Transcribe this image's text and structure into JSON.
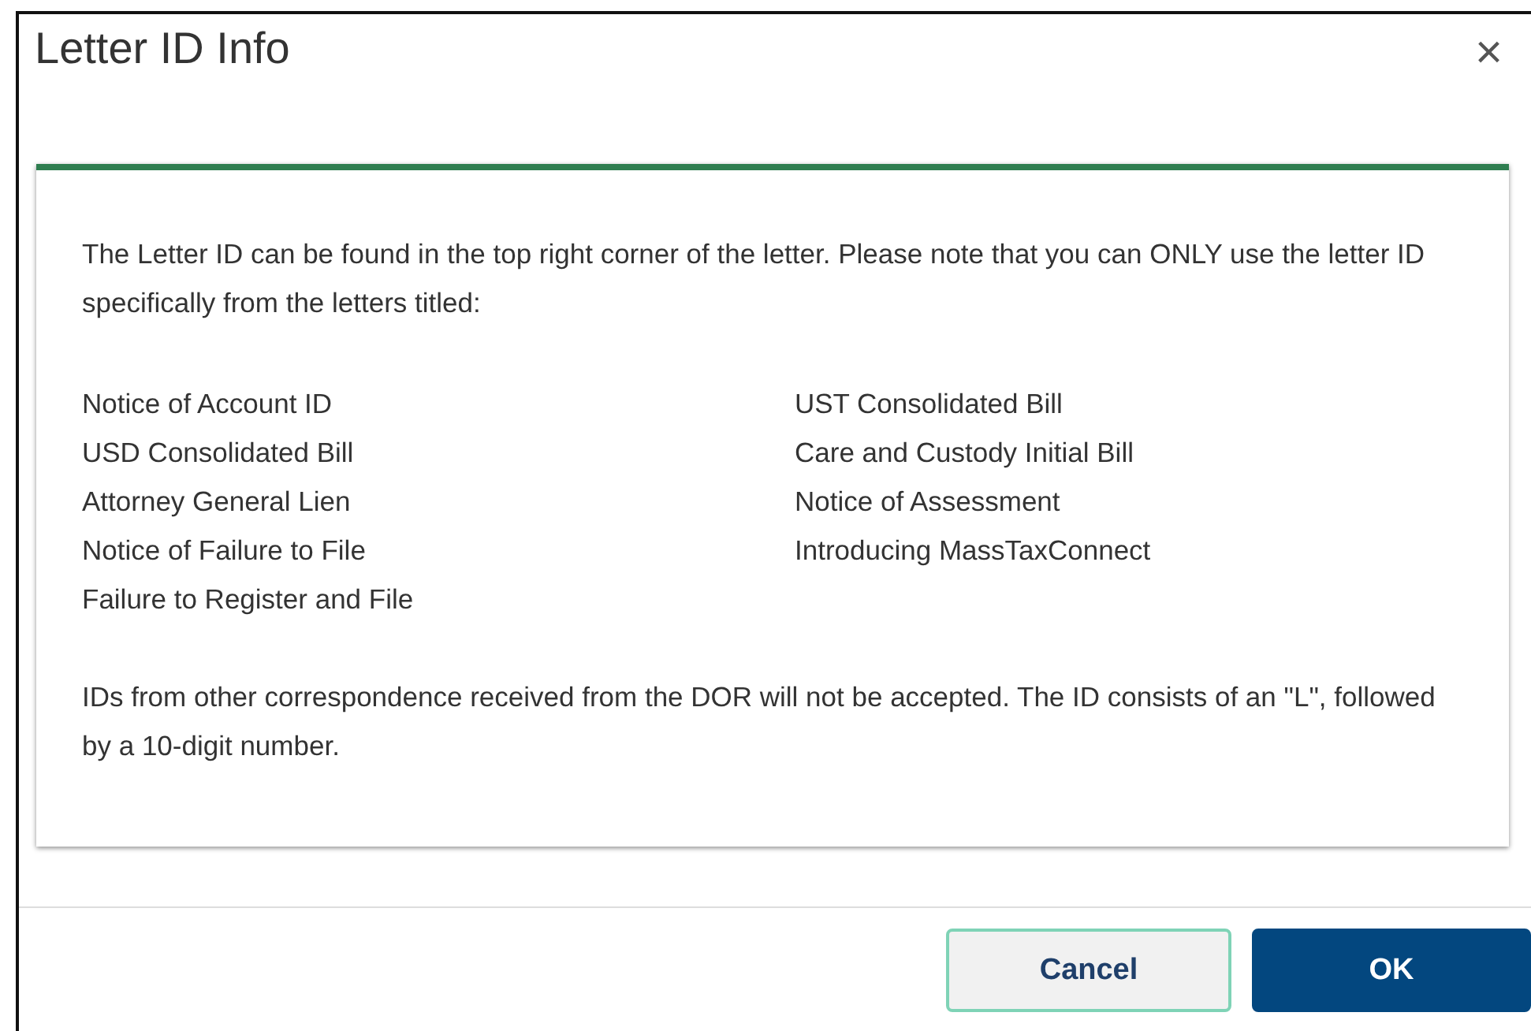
{
  "dialog": {
    "title": "Letter ID Info",
    "close": "×"
  },
  "content": {
    "intro": "The Letter ID can be found in the top right corner of the letter. Please note that you can ONLY use the letter ID specifically from the letters titled:",
    "letters_left": [
      "Notice of Account ID",
      "USD Consolidated Bill",
      "Attorney General Lien",
      "Notice of Failure to File",
      "Failure to Register and File"
    ],
    "letters_right": [
      "UST Consolidated Bill",
      "Care and Custody Initial Bill",
      "Notice of Assessment",
      "Introducing MassTaxConnect"
    ],
    "note": "IDs from other correspondence received from the DOR will not be accepted. The ID consists of an \"L\", followed by a 10-digit number."
  },
  "buttons": [
    {
      "label": "Cancel",
      "kind": "secondary"
    },
    {
      "label": "OK",
      "kind": "primary"
    }
  ]
}
